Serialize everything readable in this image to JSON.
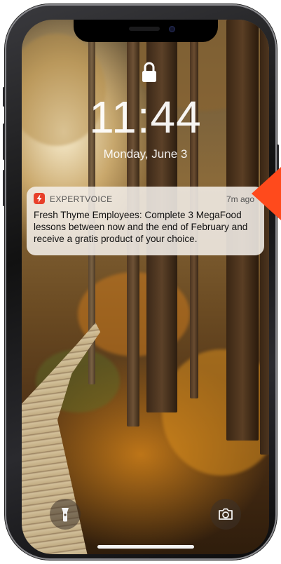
{
  "lock_screen": {
    "time": "11:44",
    "date": "Monday, June 3"
  },
  "notification": {
    "app_name": "EXPERTVOICE",
    "time_ago": "7m ago",
    "message": "Fresh Thyme Employees: Complete 3 MegaFood lessons between now and the end of February and receive a gratis product of your choice."
  },
  "colors": {
    "accent_arrow": "#ff4a1c",
    "app_icon": "#e8402a"
  },
  "icons": {
    "lock": "lock-icon",
    "app": "expertvoice-logo-icon",
    "flashlight": "flashlight-icon",
    "camera": "camera-icon"
  }
}
